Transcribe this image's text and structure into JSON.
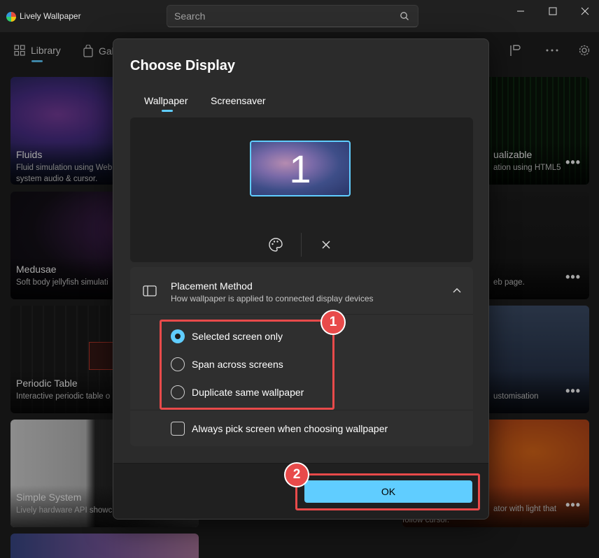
{
  "window": {
    "title": "Lively Wallpaper",
    "search_placeholder": "Search"
  },
  "nav": {
    "library_label": "Library",
    "gallery_label": "Gal"
  },
  "cards": [
    {
      "title": "Fluids",
      "desc1": "Fluid simulation using Web",
      "desc2": "system audio & cursor."
    },
    {
      "title": "Medusae",
      "desc1": "Soft body jellyfish simulati",
      "desc2": ""
    },
    {
      "title": "Periodic Table",
      "desc1": "Interactive periodic table o",
      "desc2": ""
    },
    {
      "title": "Simple System",
      "desc1": "Lively hardware API showc",
      "desc2": ""
    },
    {
      "title": "ualizable",
      "desc1": "ation using HTML5",
      "desc2": ""
    },
    {
      "title": "",
      "desc1": "eb page.",
      "desc2": ""
    },
    {
      "title": "",
      "desc1": "ustomisation",
      "desc2": ""
    },
    {
      "title": "",
      "desc1": "ator with light that",
      "desc2": "follow cursor."
    }
  ],
  "dialog": {
    "title": "Choose Display",
    "tabs": [
      "Wallpaper",
      "Screensaver"
    ],
    "monitor_number": "1",
    "placement": {
      "title": "Placement Method",
      "subtitle": "How wallpaper is applied to connected display devices",
      "options": [
        "Selected screen only",
        "Span across screens",
        "Duplicate same wallpaper"
      ],
      "selected_index": 0
    },
    "always_pick_label": "Always pick screen when choosing wallpaper",
    "always_pick_checked": false,
    "ok_label": "OK"
  },
  "annotations": {
    "badge_1": "1",
    "badge_2": "2",
    "color": "#e84a4a"
  },
  "colors": {
    "accent": "#60cdff",
    "background": "#202020",
    "dialog": "#2b2b2b"
  }
}
